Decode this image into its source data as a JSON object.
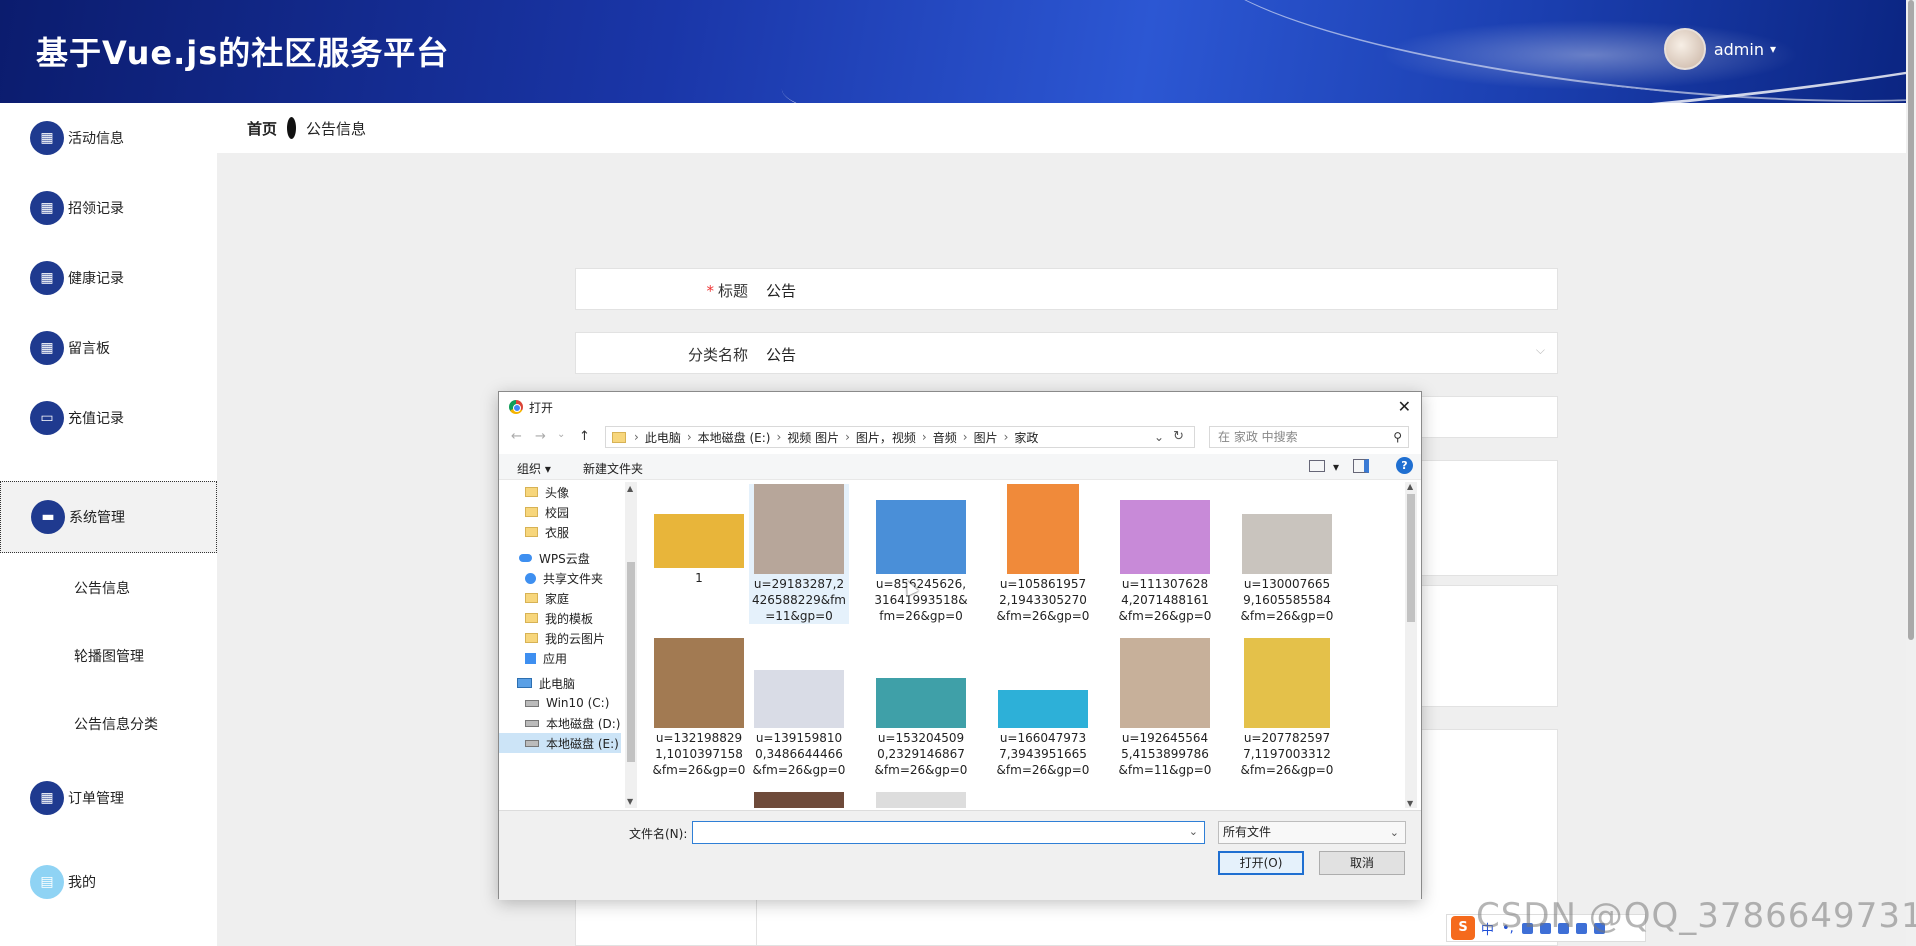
{
  "header": {
    "title": "基于Vue.js的社区服务平台",
    "user_name": "admin",
    "caret": "▾"
  },
  "breadcrumb": {
    "home": "首页",
    "current": "公告信息"
  },
  "sidebar": {
    "items": [
      {
        "label": "活动信息",
        "icon": "grid-icon"
      },
      {
        "label": "招领记录",
        "icon": "grid-icon"
      },
      {
        "label": "健康记录",
        "icon": "grid-icon"
      },
      {
        "label": "留言板",
        "icon": "grid-icon"
      },
      {
        "label": "充值记录",
        "icon": "monitor-icon"
      },
      {
        "label": "系统管理",
        "icon": "ticket-icon"
      },
      {
        "label": "订单管理",
        "icon": "grid-icon"
      },
      {
        "label": "我的",
        "icon": "card-icon"
      }
    ],
    "sub_items": [
      "公告信息",
      "轮播图管理",
      "公告信息分类"
    ]
  },
  "form": {
    "title_label": "标题",
    "title_required_mark": "*",
    "title_value": "公告",
    "category_label": "分类名称",
    "category_value": "公告",
    "category_dropdown": "⌵"
  },
  "dialog": {
    "title": "打开",
    "close": "✕",
    "nav": {
      "back": "←",
      "forward": "→",
      "recent": "⌄",
      "up": "↑"
    },
    "path": [
      "此电脑",
      "本地磁盘 (E:)",
      "视频 图片",
      "图片，视频",
      "音频",
      "图片",
      "家政"
    ],
    "path_sep": "›",
    "path_dropdown": "⌄",
    "refresh": "↻",
    "search_placeholder": "在 家政 中搜索",
    "search_icon": "⚲",
    "toolbar": {
      "organize": "组织 ▾",
      "new_folder": "新建文件夹",
      "view_menu": "▾",
      "help": "?"
    },
    "tree": [
      {
        "label": "头像",
        "kind": "folder"
      },
      {
        "label": "校园",
        "kind": "folder"
      },
      {
        "label": "衣服",
        "kind": "folder"
      },
      {
        "label": "WPS云盘",
        "kind": "cloud"
      },
      {
        "label": "共享文件夹",
        "kind": "share"
      },
      {
        "label": "家庭",
        "kind": "folder"
      },
      {
        "label": "我的模板",
        "kind": "folder"
      },
      {
        "label": "我的云图片",
        "kind": "folder"
      },
      {
        "label": "应用",
        "kind": "apps"
      },
      {
        "label": "此电脑",
        "kind": "pc"
      },
      {
        "label": "Win10 (C:)",
        "kind": "drive"
      },
      {
        "label": "本地磁盘 (D:)",
        "kind": "drive"
      },
      {
        "label": "本地磁盘 (E:)",
        "kind": "drive"
      }
    ],
    "scroll_up": "▲",
    "scroll_down": "▼",
    "files": [
      {
        "name": "1",
        "color": "#e8b53a"
      },
      {
        "name": "u=29183287,2426588229&fm=11&gp=0",
        "color": "#b7a69a"
      },
      {
        "name": "u=856245626,31641993518&fm=26&gp=0",
        "color": "#4a8fd8"
      },
      {
        "name": "u=1058619572,1943305270&fm=26&gp=0",
        "color": "#f08a3a"
      },
      {
        "name": "u=1113076284,2071488161&fm=26&gp=0",
        "color": "#c88ad8"
      },
      {
        "name": "u=1300076659,1605585584&fm=26&gp=0",
        "color": "#c9c4be"
      },
      {
        "name": "u=1321988291,1010397158&fm=26&gp=0",
        "color": "#a27a52"
      },
      {
        "name": "u=1391598100,3486644466&fm=26&gp=0",
        "color": "#d9dce6"
      },
      {
        "name": "u=1532045090,2329146867&fm=26&gp=0",
        "color": "#3fa0a8"
      },
      {
        "name": "u=1660479737,3943951665&fm=26&gp=0",
        "color": "#2db0d8"
      },
      {
        "name": "u=1926455645,4153899786&fm=11&gp=0",
        "color": "#c7b09a"
      },
      {
        "name": "u=2077825977,1197003312&fm=26&gp=0",
        "color": "#e4c14a"
      },
      {
        "name": "",
        "color": "#6e4a3a"
      },
      {
        "name": "",
        "color": "#dddddd"
      }
    ],
    "file_name_label": "文件名(N):",
    "file_name_value": "",
    "file_name_dropdown": "⌄",
    "file_type": "所有文件",
    "file_type_dropdown": "⌄",
    "open_button": "打开(O)",
    "cancel_button": "取消"
  },
  "ime": {
    "logo": "S",
    "lang": "中",
    "punct": "•,"
  },
  "watermark": "CSDN @QQ_3786649731"
}
